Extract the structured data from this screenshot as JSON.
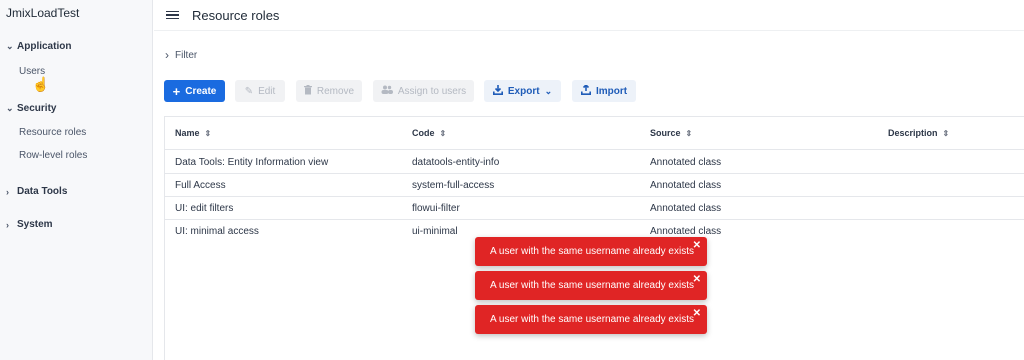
{
  "app": {
    "title": "JmixLoadTest"
  },
  "sidebar": {
    "groups": [
      {
        "label": "Application",
        "items": [
          {
            "label": "Users"
          }
        ]
      },
      {
        "label": "Security",
        "items": [
          {
            "label": "Resource roles"
          },
          {
            "label": "Row-level roles"
          }
        ]
      },
      {
        "label": "Data Tools",
        "items": []
      },
      {
        "label": "System",
        "items": []
      }
    ]
  },
  "header": {
    "title": "Resource roles"
  },
  "filter": {
    "label": "Filter"
  },
  "toolbar": {
    "create": "Create",
    "edit": "Edit",
    "remove": "Remove",
    "assign": "Assign to users",
    "export": "Export",
    "import": "Import"
  },
  "grid": {
    "columns": [
      "Name",
      "Code",
      "Source",
      "Description"
    ],
    "rows": [
      {
        "name": "Data Tools: Entity Information view",
        "code": "datatools-entity-info",
        "source": "Annotated class",
        "description": ""
      },
      {
        "name": "Full Access",
        "code": "system-full-access",
        "source": "Annotated class",
        "description": ""
      },
      {
        "name": "UI: edit filters",
        "code": "flowui-filter",
        "source": "Annotated class",
        "description": ""
      },
      {
        "name": "UI: minimal access",
        "code": "ui-minimal",
        "source": "Annotated class",
        "description": ""
      }
    ]
  },
  "notifications": [
    {
      "text": "A user with the same username already exists"
    },
    {
      "text": "A user with the same username already exists"
    },
    {
      "text": "A user with the same username already exists"
    }
  ],
  "colors": {
    "primary": "#1a6be0",
    "error": "#e02525"
  }
}
